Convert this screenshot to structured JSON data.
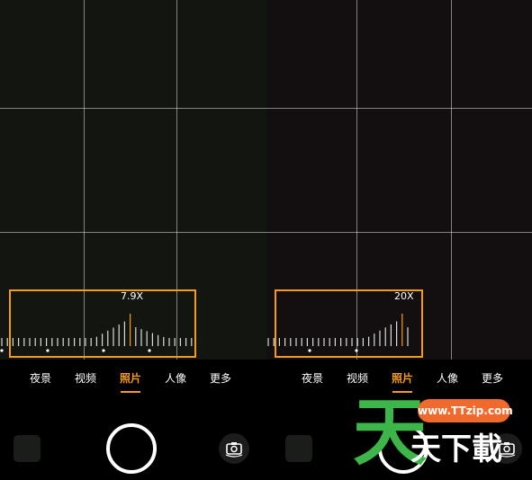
{
  "colors": {
    "accent": "#f39c1f",
    "watermark_green": "#3cb648",
    "watermark_orange": "#ef6a2c"
  },
  "panels": [
    {
      "id": "left",
      "zoom_label": "7.9X",
      "modes": [
        "夜景",
        "视频",
        "照片",
        "人像",
        "更多"
      ],
      "active_mode": "照片"
    },
    {
      "id": "right",
      "zoom_label": "20X",
      "modes": [
        "夜景",
        "视频",
        "照片",
        "人像",
        "更多"
      ],
      "active_mode": "照片"
    }
  ],
  "watermark": {
    "big_char": "天",
    "url": "www.TTzip.com",
    "text": "天下載"
  },
  "icons": {
    "shutter": "shutter-button",
    "switch": "camera-switch-icon"
  }
}
